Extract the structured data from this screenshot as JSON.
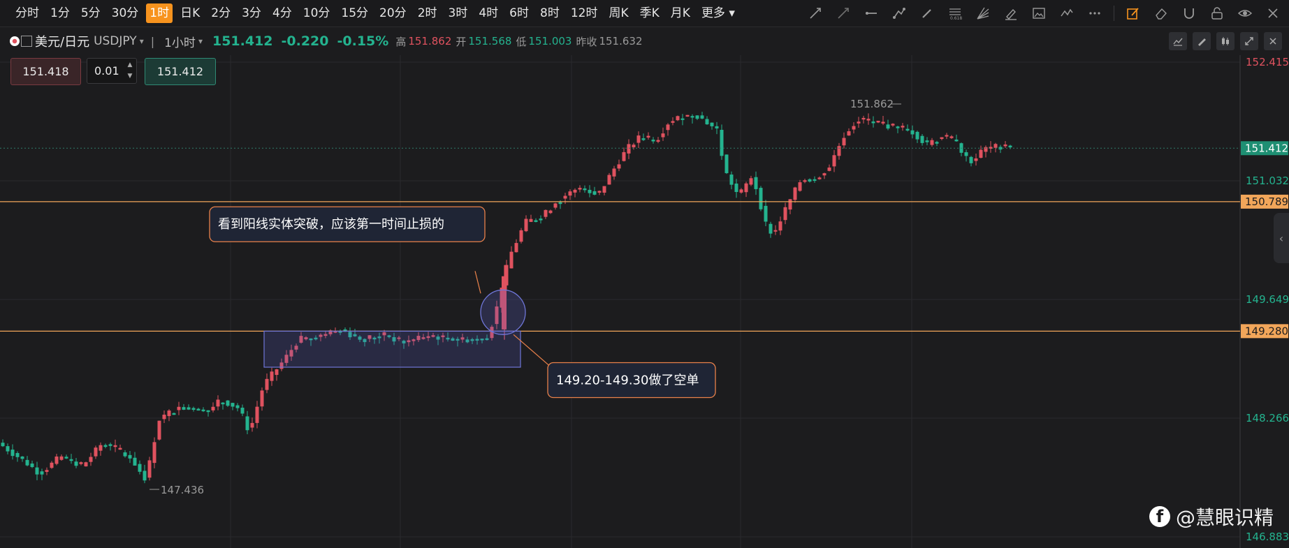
{
  "toolbar": {
    "timeframes": [
      "分时",
      "1分",
      "5分",
      "30分",
      "1时",
      "日K",
      "2分",
      "3分",
      "4分",
      "10分",
      "15分",
      "20分",
      "2时",
      "3时",
      "4时",
      "6时",
      "8时",
      "12时",
      "周K",
      "季K",
      "月K",
      "更多"
    ],
    "active": "1时",
    "tool_icons": [
      "trend-line-icon",
      "ray-icon",
      "horizontal-line-icon",
      "segment-icon",
      "pen-icon",
      "fibonacci-icon",
      "fan-icon",
      "brush-icon",
      "image-icon",
      "wave-icon",
      "more-dots-icon",
      "edit-icon",
      "eraser-icon",
      "magnet-icon",
      "lock-icon",
      "eye-icon",
      "close-icon"
    ]
  },
  "info": {
    "symbol": "美元/日元",
    "code": "USDJPY",
    "interval": "1小时",
    "price": "151.412",
    "change": "-0.220",
    "change_pct": "-0.15%",
    "high_label": "高",
    "high": "151.862",
    "open_label": "开",
    "open": "151.568",
    "low_label": "低",
    "low": "151.003",
    "prev_label": "昨收",
    "prev": "151.632"
  },
  "order": {
    "sell": "151.418",
    "qty": "0.01",
    "buy": "151.412"
  },
  "chart_data": {
    "type": "candlestick",
    "ylim": [
      146.883,
      152.415
    ],
    "axis_labels": [
      {
        "value": "152.415",
        "color": "#e0525f"
      },
      {
        "value": "151.032",
        "color": "#24b38f"
      },
      {
        "value": "149.649",
        "color": "#24b38f"
      },
      {
        "value": "148.266",
        "color": "#24b38f"
      },
      {
        "value": "146.883",
        "color": "#24b38f"
      }
    ],
    "current_price": "151.412",
    "horizontal_lines": [
      {
        "value": 150.789,
        "label": "150.789"
      },
      {
        "value": 149.28,
        "label": "149.280"
      }
    ],
    "high_marker": "151.862",
    "low_marker": "147.436",
    "colors": {
      "up": "#e0525f",
      "down": "#24b38f",
      "line": "#f2a65a",
      "box": "#6f76d8"
    },
    "annotations": [
      {
        "text": "看到阳线实体突破，应该第一时间止损的"
      },
      {
        "text": "149.20-149.30做了空单"
      }
    ]
  },
  "watermark": {
    "text": "@慧眼识精"
  }
}
